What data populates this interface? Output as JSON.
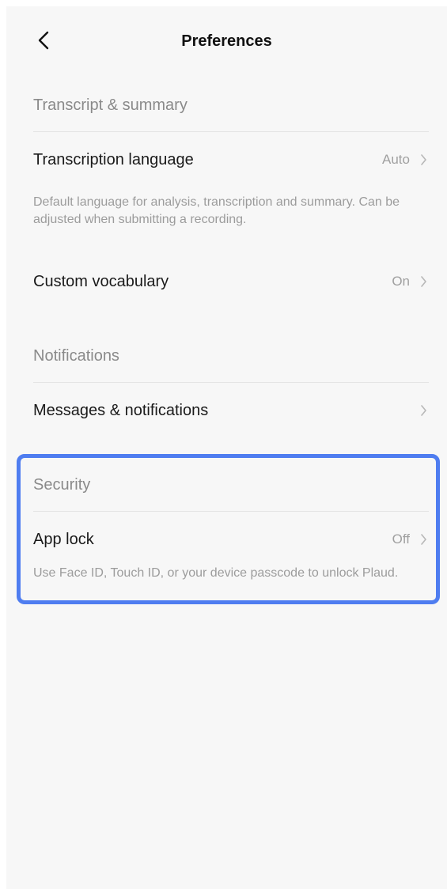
{
  "header": {
    "title": "Preferences",
    "back_icon": "chevron-left-icon"
  },
  "sections": [
    {
      "title": "Transcript & summary",
      "items": [
        {
          "label": "Transcription language",
          "value": "Auto",
          "description": "Default language for analysis, transcription and summary. Can be adjusted when submitting a recording."
        },
        {
          "label": "Custom vocabulary",
          "value": "On"
        }
      ]
    },
    {
      "title": "Notifications",
      "items": [
        {
          "label": "Messages & notifications"
        }
      ]
    },
    {
      "title": "Security",
      "items": [
        {
          "label": "App lock",
          "value": "Off",
          "description": "Use Face ID, Touch ID, or your device passcode to unlock Plaud."
        }
      ]
    }
  ],
  "colors": {
    "background": "#f7f7f7",
    "highlight_border": "#4f7df0",
    "section_title": "#8a8a8a",
    "row_label": "#1a1a1a",
    "secondary_text": "#9c9c9c"
  }
}
